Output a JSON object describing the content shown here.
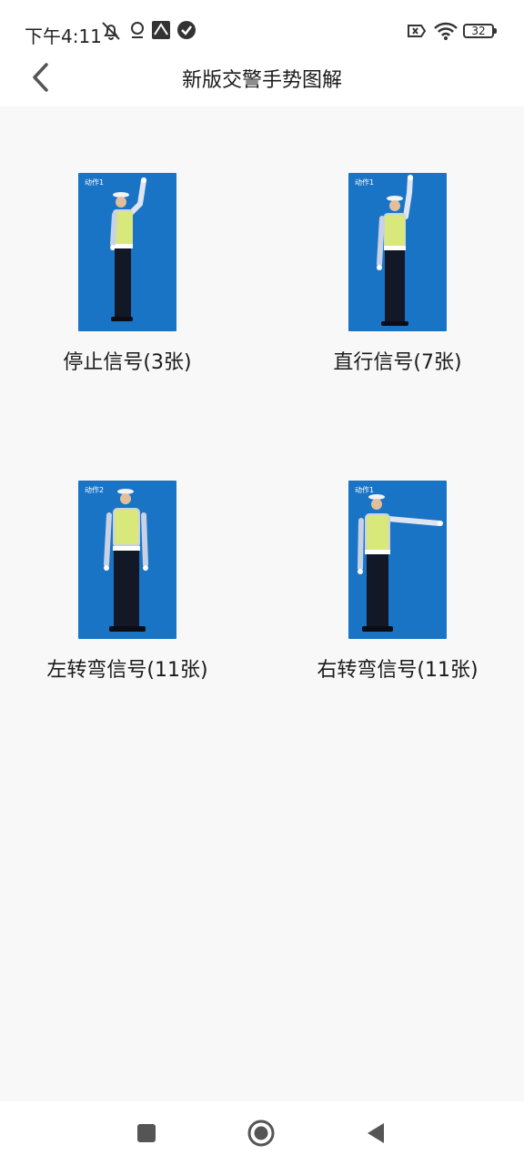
{
  "status": {
    "time": "下午4:11",
    "battery": "32",
    "icons": [
      "muted-bell-icon",
      "location-icon",
      "app-icon",
      "check-circle-icon",
      "sim-error-icon",
      "wifi-icon",
      "battery-icon"
    ]
  },
  "header": {
    "title": "新版交警手势图解",
    "back_icon": "back-arrow-icon"
  },
  "gestures": [
    {
      "label": "停止信号(3张)",
      "image_caption": "动作1"
    },
    {
      "label": "直行信号(7张)",
      "image_caption": "动作1"
    },
    {
      "label": "左转弯信号(11张)",
      "image_caption": "动作2"
    },
    {
      "label": "右转弯信号(11张)",
      "image_caption": "动作1"
    }
  ],
  "navbar": {
    "icons": [
      "recent-apps-icon",
      "home-icon",
      "back-triangle-icon"
    ]
  },
  "colors": {
    "photo_bg": "#1a74c6",
    "vest": "#d8e87a",
    "uniform_shirt": "#c9d2e4",
    "trousers": "#121826"
  }
}
